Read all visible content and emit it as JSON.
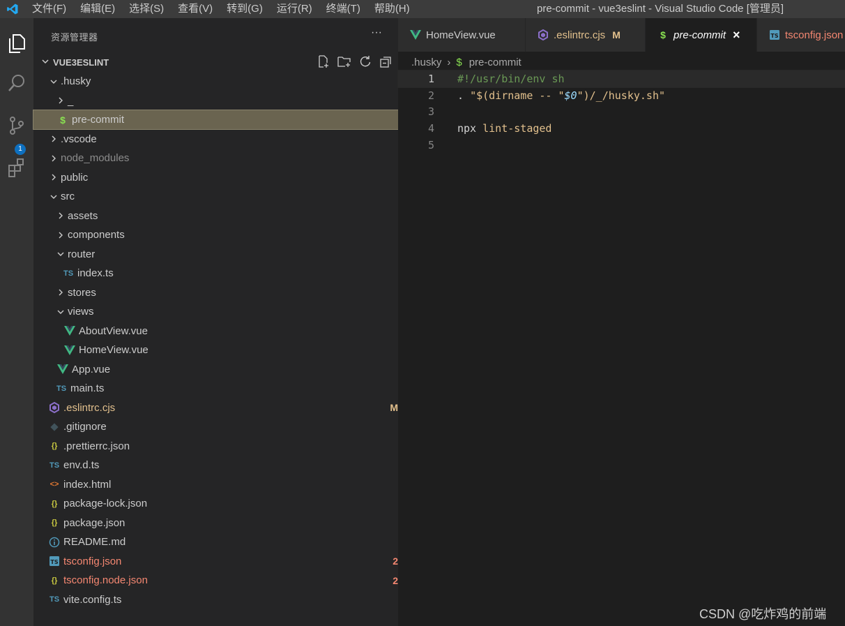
{
  "titlebar": {
    "menus": [
      "文件(F)",
      "编辑(E)",
      "选择(S)",
      "查看(V)",
      "转到(G)",
      "运行(R)",
      "终端(T)",
      "帮助(H)"
    ],
    "window_title": "pre-commit - vue3eslint - Visual Studio Code [管理员]"
  },
  "activitybar": {
    "icons": [
      "explorer-icon",
      "search-icon",
      "source-control-icon",
      "extensions-icon"
    ],
    "scm_badge": "1"
  },
  "sidebar": {
    "header": "资源管理器",
    "more": "···",
    "project": "VUE3ESLINT",
    "tree": [
      {
        "label": ".husky",
        "icon": "",
        "twisty": "open",
        "color": "#cccccc",
        "badge": ""
      },
      {
        "label": "_",
        "icon": "",
        "twisty": "closed",
        "color": "#cccccc",
        "badge": ""
      },
      {
        "label": "pre-commit",
        "icon": "$",
        "twisty": "",
        "color": "#cccccc",
        "badge": ""
      },
      {
        "label": ".vscode",
        "icon": "",
        "twisty": "closed",
        "color": "#cccccc",
        "badge": ""
      },
      {
        "label": "node_modules",
        "icon": "",
        "twisty": "closed",
        "color": "#8c8c8c",
        "badge": ""
      },
      {
        "label": "public",
        "icon": "",
        "twisty": "closed",
        "color": "#cccccc",
        "badge": ""
      },
      {
        "label": "src",
        "icon": "",
        "twisty": "open",
        "color": "#cccccc",
        "badge": ""
      },
      {
        "label": "assets",
        "icon": "",
        "twisty": "closed",
        "color": "#cccccc",
        "badge": ""
      },
      {
        "label": "components",
        "icon": "",
        "twisty": "closed",
        "color": "#cccccc",
        "badge": ""
      },
      {
        "label": "router",
        "icon": "",
        "twisty": "open",
        "color": "#cccccc",
        "badge": ""
      },
      {
        "label": "index.ts",
        "icon": "TS",
        "twisty": "",
        "color": "#cccccc",
        "badge": ""
      },
      {
        "label": "stores",
        "icon": "",
        "twisty": "closed",
        "color": "#cccccc",
        "badge": ""
      },
      {
        "label": "views",
        "icon": "",
        "twisty": "open",
        "color": "#cccccc",
        "badge": ""
      },
      {
        "label": "AboutView.vue",
        "icon": "V",
        "twisty": "",
        "color": "#cccccc",
        "badge": ""
      },
      {
        "label": "HomeView.vue",
        "icon": "V",
        "twisty": "",
        "color": "#cccccc",
        "badge": ""
      },
      {
        "label": "App.vue",
        "icon": "V",
        "twisty": "",
        "color": "#cccccc",
        "badge": ""
      },
      {
        "label": "main.ts",
        "icon": "TS",
        "twisty": "",
        "color": "#cccccc",
        "badge": ""
      },
      {
        "label": ".eslintrc.cjs",
        "icon": "eslint",
        "twisty": "",
        "color": "#e2c08d",
        "badge": "M"
      },
      {
        "label": ".gitignore",
        "icon": "git",
        "twisty": "",
        "color": "#cccccc",
        "badge": ""
      },
      {
        "label": ".prettierrc.json",
        "icon": "{}",
        "twisty": "",
        "color": "#cccccc",
        "badge": ""
      },
      {
        "label": "env.d.ts",
        "icon": "TS",
        "twisty": "",
        "color": "#cccccc",
        "badge": ""
      },
      {
        "label": "index.html",
        "icon": "<>",
        "twisty": "",
        "color": "#cccccc",
        "badge": ""
      },
      {
        "label": "package-lock.json",
        "icon": "{}",
        "twisty": "",
        "color": "#cccccc",
        "badge": ""
      },
      {
        "label": "package.json",
        "icon": "{}",
        "twisty": "",
        "color": "#cccccc",
        "badge": ""
      },
      {
        "label": "README.md",
        "icon": "info",
        "twisty": "",
        "color": "#cccccc",
        "badge": ""
      },
      {
        "label": "tsconfig.json",
        "icon": "tsbox",
        "twisty": "",
        "color": "#f48771",
        "badge": "2"
      },
      {
        "label": "tsconfig.node.json",
        "icon": "{}",
        "twisty": "",
        "color": "#f48771",
        "badge": "2"
      },
      {
        "label": "vite.config.ts",
        "icon": "TS",
        "twisty": "",
        "color": "#cccccc",
        "badge": ""
      }
    ]
  },
  "tabs": [
    {
      "label": "HomeView.vue",
      "icon": "V",
      "color": "#cccccc",
      "suffix": "",
      "active": false
    },
    {
      "label": ".eslintrc.cjs",
      "icon": "eslint",
      "color": "#e2c08d",
      "suffix": "M",
      "active": false
    },
    {
      "label": "pre-commit",
      "icon": "$",
      "color": "#ffffff",
      "suffix": "×",
      "active": true
    },
    {
      "label": "tsconfig.json",
      "icon": "tsbox",
      "color": "#f48771",
      "suffix": "",
      "active": false
    }
  ],
  "breadcrumb": {
    "folder": ".husky",
    "sep": "›",
    "icon": "$",
    "file": "pre-commit"
  },
  "editor": {
    "current_line": 1,
    "lines": [
      {
        "n": "1",
        "tokens": [
          {
            "t": "#!/usr/bin/env sh",
            "c": "tok-comment"
          }
        ]
      },
      {
        "n": "2",
        "tokens": [
          {
            "t": ". ",
            "c": "tok-text"
          },
          {
            "t": "\"$(dirname -- \"",
            "c": "tok-str-y"
          },
          {
            "t": "$0",
            "c": "tok-var"
          },
          {
            "t": "\")/_/husky.sh\"",
            "c": "tok-str-y"
          }
        ]
      },
      {
        "n": "3",
        "tokens": []
      },
      {
        "n": "4",
        "tokens": [
          {
            "t": "npx ",
            "c": "tok-text"
          },
          {
            "t": "lint-staged",
            "c": "tok-str-y"
          }
        ]
      },
      {
        "n": "5",
        "tokens": []
      }
    ]
  },
  "watermark": "CSDN @吃炸鸡的前端",
  "colors": {
    "vue_green": "#41b883",
    "ts_blue": "#519aba",
    "json_yellow": "#cbcb41",
    "eslint_purple": "#8b6fc9",
    "html_orange": "#e37933",
    "shell_green": "#89e051"
  }
}
